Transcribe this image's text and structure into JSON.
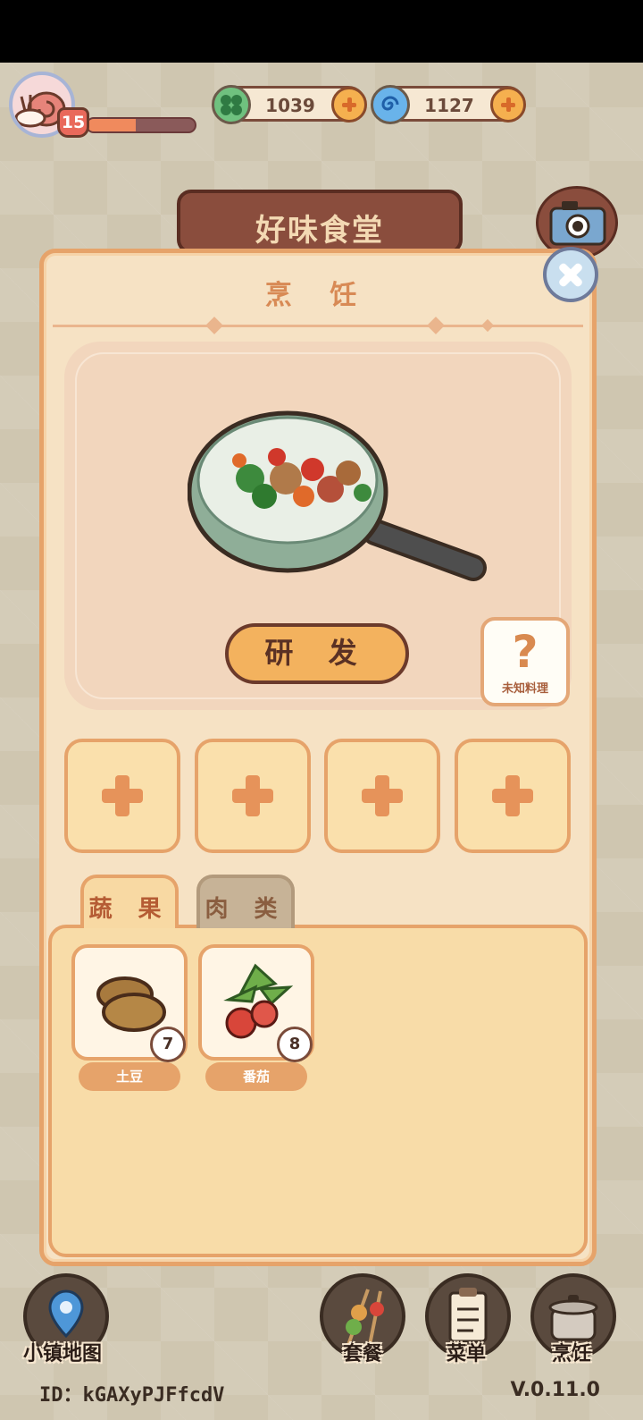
{
  "hud": {
    "level": "15",
    "xp_progress": 0.45,
    "currencies": [
      {
        "name": "clover",
        "value": "1039",
        "color": "#4fae62"
      },
      {
        "name": "swirl",
        "value": "1127",
        "color": "#3f8fd7"
      }
    ]
  },
  "sign": {
    "title": "好味食堂"
  },
  "panel": {
    "title": "烹 饪",
    "research_button": "研 发",
    "unknown_dish_label": "未知料理",
    "unknown_dish_symbol": "?"
  },
  "slots": [
    {
      "icon": "plus-icon"
    },
    {
      "icon": "plus-icon"
    },
    {
      "icon": "plus-icon"
    },
    {
      "icon": "plus-icon"
    }
  ],
  "tabs": [
    {
      "label": "蔬 果",
      "active": true
    },
    {
      "label": "肉 类",
      "active": false
    }
  ],
  "ingredients": [
    {
      "name": "土豆",
      "count": "7",
      "icon": "potato-icon"
    },
    {
      "name": "番茄",
      "count": "8",
      "icon": "tomato-icon"
    }
  ],
  "bottom_nav": [
    {
      "label": "小镇地图",
      "icon": "map-pin-icon"
    },
    {
      "label": "套餐",
      "icon": "skewer-icon"
    },
    {
      "label": "菜单",
      "icon": "clipboard-icon"
    },
    {
      "label": "烹饪",
      "icon": "pot-icon"
    }
  ],
  "footer": {
    "id": "ID：kGAXyPJFfcdV",
    "version": "V.0.11.0"
  }
}
